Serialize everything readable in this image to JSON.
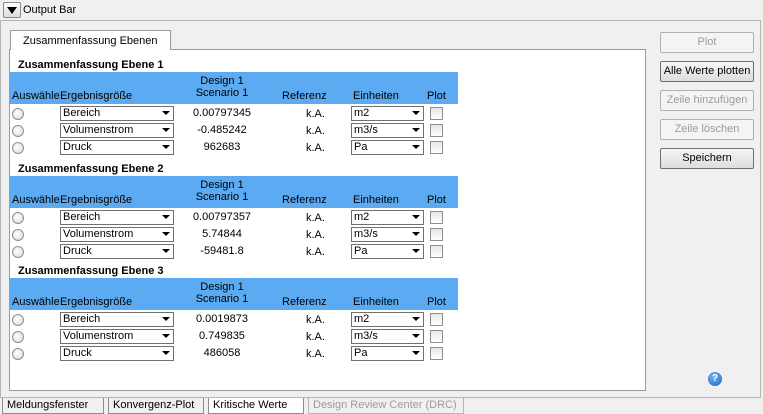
{
  "window": {
    "title": "Output Bar"
  },
  "tab": {
    "label": "Zusammenfassung Ebenen"
  },
  "columns": {
    "select": "Auswähle",
    "result": "Ergebnisgröße",
    "design_line1": "Design 1",
    "design_line2": "Scenario 1",
    "reference": "Referenz",
    "units": "Einheiten",
    "plot": "Plot"
  },
  "sections": [
    {
      "title": "Zusammenfassung Ebene 1",
      "rows": [
        {
          "result": "Bereich",
          "value": "0.00797345",
          "reference": "k.A.",
          "unit": "m2"
        },
        {
          "result": "Volumenstrom",
          "value": "-0.485242",
          "reference": "k.A.",
          "unit": "m3/s"
        },
        {
          "result": "Druck",
          "value": "962683",
          "reference": "k.A.",
          "unit": "Pa"
        }
      ]
    },
    {
      "title": "Zusammenfassung Ebene 2",
      "rows": [
        {
          "result": "Bereich",
          "value": "0.00797357",
          "reference": "k.A.",
          "unit": "m2"
        },
        {
          "result": "Volumenstrom",
          "value": "5.74844",
          "reference": "k.A.",
          "unit": "m3/s"
        },
        {
          "result": "Druck",
          "value": "-59481.8",
          "reference": "k.A.",
          "unit": "Pa"
        }
      ]
    },
    {
      "title": "Zusammenfassung Ebene 3",
      "rows": [
        {
          "result": "Bereich",
          "value": "0.0019873",
          "reference": "k.A.",
          "unit": "m2"
        },
        {
          "result": "Volumenstrom",
          "value": "0.749835",
          "reference": "k.A.",
          "unit": "m3/s"
        },
        {
          "result": "Druck",
          "value": "486058",
          "reference": "k.A.",
          "unit": "Pa"
        }
      ]
    }
  ],
  "buttons": {
    "plot": "Plot",
    "plot_all": "Alle Werte plotten",
    "add_row": "Zeile hinzufügen",
    "delete_row": "Zeile löschen",
    "save": "Speichern"
  },
  "bottom_tabs": [
    {
      "label": "Meldungsfenster"
    },
    {
      "label": "Konvergenz-Plot"
    },
    {
      "label": "Kritische Werte"
    },
    {
      "label": "Design Review Center (DRC)"
    }
  ],
  "help": {
    "glyph": "?"
  },
  "colors": {
    "header_bg": "#5baaf2",
    "help_icon": "#1c5fbf"
  },
  "icons": [
    "collapse-arrow-icon",
    "radio-icon",
    "dropdown-arrow-icon",
    "checkbox-icon",
    "help-icon"
  ]
}
